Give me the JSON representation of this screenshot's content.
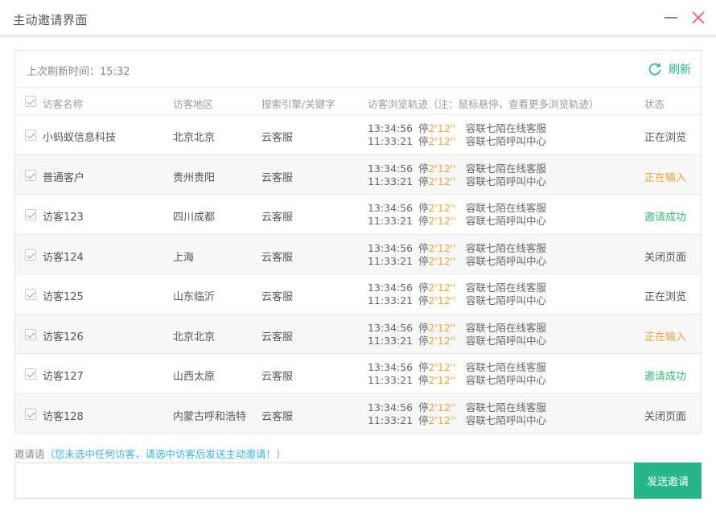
{
  "window": {
    "title": "主动邀请界面"
  },
  "toolbar": {
    "last_refresh_label": "上次刷新时间：15:32",
    "refresh_label": "刷新"
  },
  "table": {
    "headers": {
      "name": "访客名称",
      "region": "访客地区",
      "search": "搜索引擎/关键字",
      "trail": "访客浏览轨迹（注：鼠标悬停，查看更多浏览轨迹）",
      "status": "状态"
    },
    "rows": [
      {
        "name": "小蚂蚁信息科技",
        "region": "北京北京",
        "search": "云客服",
        "trail": [
          {
            "time": "13:34:56",
            "stay": "停",
            "dur": "2'12''",
            "page": "容联七陌在线客服"
          },
          {
            "time": "11:33:21",
            "stay": "停",
            "dur": "2'12''",
            "page": "容联七陌呼叫中心"
          }
        ],
        "status": "正在浏览",
        "status_color": "#555555"
      },
      {
        "name": "普通客户",
        "region": "贵州贵阳",
        "search": "云客服",
        "trail": [
          {
            "time": "13:34:56",
            "stay": "停",
            "dur": "2'12''",
            "page": "容联七陌在线客服"
          },
          {
            "time": "11:33:21",
            "stay": "停",
            "dur": "2'12''",
            "page": "容联七陌呼叫中心"
          }
        ],
        "status": "正在输入",
        "status_color": "#f0a33a"
      },
      {
        "name": "访客123",
        "region": "四川成都",
        "search": "云客服",
        "trail": [
          {
            "time": "13:34:56",
            "stay": "停",
            "dur": "2'12''",
            "page": "容联七陌在线客服"
          },
          {
            "time": "11:33:21",
            "stay": "停",
            "dur": "2'12''",
            "page": "容联七陌呼叫中心"
          }
        ],
        "status": "邀请成功",
        "status_color": "#3cb878"
      },
      {
        "name": "访客124",
        "region": "上海",
        "search": "云客服",
        "trail": [
          {
            "time": "13:34:56",
            "stay": "停",
            "dur": "2'12''",
            "page": "容联七陌在线客服"
          },
          {
            "time": "11:33:21",
            "stay": "停",
            "dur": "2'12''",
            "page": "容联七陌呼叫中心"
          }
        ],
        "status": "关闭页面",
        "status_color": "#555555"
      },
      {
        "name": "访客125",
        "region": "山东临沂",
        "search": "云客服",
        "trail": [
          {
            "time": "13:34:56",
            "stay": "停",
            "dur": "2'12''",
            "page": "容联七陌在线客服"
          },
          {
            "time": "11:33:21",
            "stay": "停",
            "dur": "2'12''",
            "page": "容联七陌呼叫中心"
          }
        ],
        "status": "正在浏览",
        "status_color": "#555555"
      },
      {
        "name": "访客126",
        "region": "北京北京",
        "search": "云客服",
        "trail": [
          {
            "time": "13:34:56",
            "stay": "停",
            "dur": "2'12''",
            "page": "容联七陌在线客服"
          },
          {
            "time": "11:33:21",
            "stay": "停",
            "dur": "2'12''",
            "page": "容联七陌呼叫中心"
          }
        ],
        "status": "正在输入",
        "status_color": "#f0a33a"
      },
      {
        "name": "访客127",
        "region": "山西太原",
        "search": "云客服",
        "trail": [
          {
            "time": "13:34:56",
            "stay": "停",
            "dur": "2'12''",
            "page": "容联七陌在线客服"
          },
          {
            "time": "11:33:21",
            "stay": "停",
            "dur": "2'12''",
            "page": "容联七陌呼叫中心"
          }
        ],
        "status": "邀请成功",
        "status_color": "#3cb878"
      },
      {
        "name": "访客128",
        "region": "内蒙古呼和浩特",
        "search": "云客服",
        "trail": [
          {
            "time": "13:34:56",
            "stay": "停",
            "dur": "2'12''",
            "page": "容联七陌在线客服"
          },
          {
            "time": "11:33:21",
            "stay": "停",
            "dur": "2'12''",
            "page": "容联七陌呼叫中心"
          }
        ],
        "status": "关闭页面",
        "status_color": "#555555"
      }
    ]
  },
  "invite": {
    "label": "邀请语",
    "hint": "（您未选中任何访客，请选中访客后发送主动邀请！）",
    "placeholder": "",
    "send_label": "发送邀请"
  },
  "colors": {
    "accent": "#27b58a",
    "warning": "#f0a33a",
    "success": "#3cb878",
    "hint": "#3ab3e0",
    "close_icon": "#e9546b"
  },
  "icons": {
    "minimize": "minimize-icon",
    "close": "close-icon",
    "refresh": "refresh-icon",
    "checkbox": "checkbox-checked-icon"
  }
}
